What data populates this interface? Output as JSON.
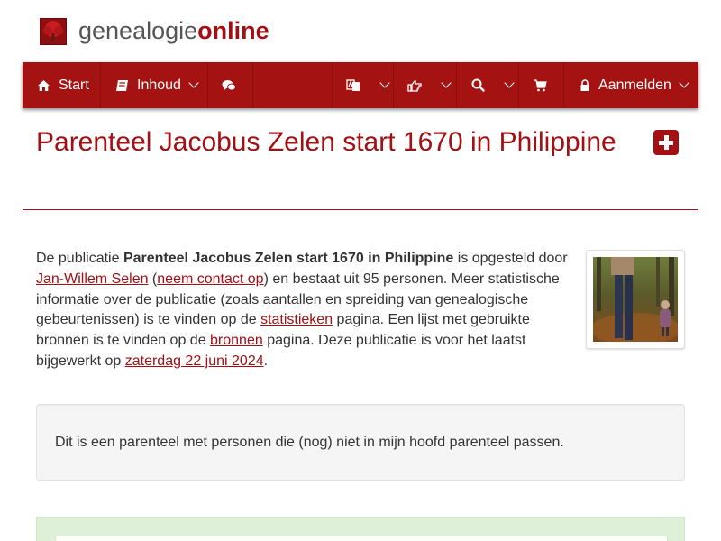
{
  "brand": {
    "logo_text_light": "genealogie",
    "logo_text_bold": "online"
  },
  "nav": {
    "start": "Start",
    "inhoud": "Inhoud",
    "login": "Aanmelden",
    "icons": [
      "home-icon",
      "book-icon",
      "comments-icon",
      "language-icon",
      "hand-pointer-icon",
      "search-icon",
      "cart-icon",
      "lock-icon"
    ]
  },
  "page": {
    "title": "Parenteel Jacobus Zelen start 1670 in Philippine"
  },
  "intro": {
    "t1": "De publicatie ",
    "pub_name": "Parenteel Jacobus Zelen start 1670 in Philippine",
    "t2": " is opgesteld door ",
    "author_link": "Jan-Willem Selen",
    "t3": " (",
    "contact_link": "neem contact op",
    "t4": ") en bestaat uit 95 personen. Meer statistische informatie over de publicatie (zoals aantallen en spreiding van genealogische gebeurtenissen) is te vinden op de ",
    "stats_link": "statistieken",
    "t5": " pagina. Een lijst met gebruikte bronnen is te vinden op de ",
    "sources_link": "bronnen",
    "t6": " pagina. Deze publicatie is voor het laatst bijgewerkt op ",
    "date_link": "zaterdag 22 juni 2024",
    "t7": "."
  },
  "note": {
    "text": "Dit is een parenteel met personen die (nog) niet in mijn hoofd parenteel passen."
  },
  "colors": {
    "brand_red": "#a51212",
    "title_red": "#a30f12",
    "well_bg": "#f5f5f5",
    "panel_green": "#dff0d8"
  }
}
